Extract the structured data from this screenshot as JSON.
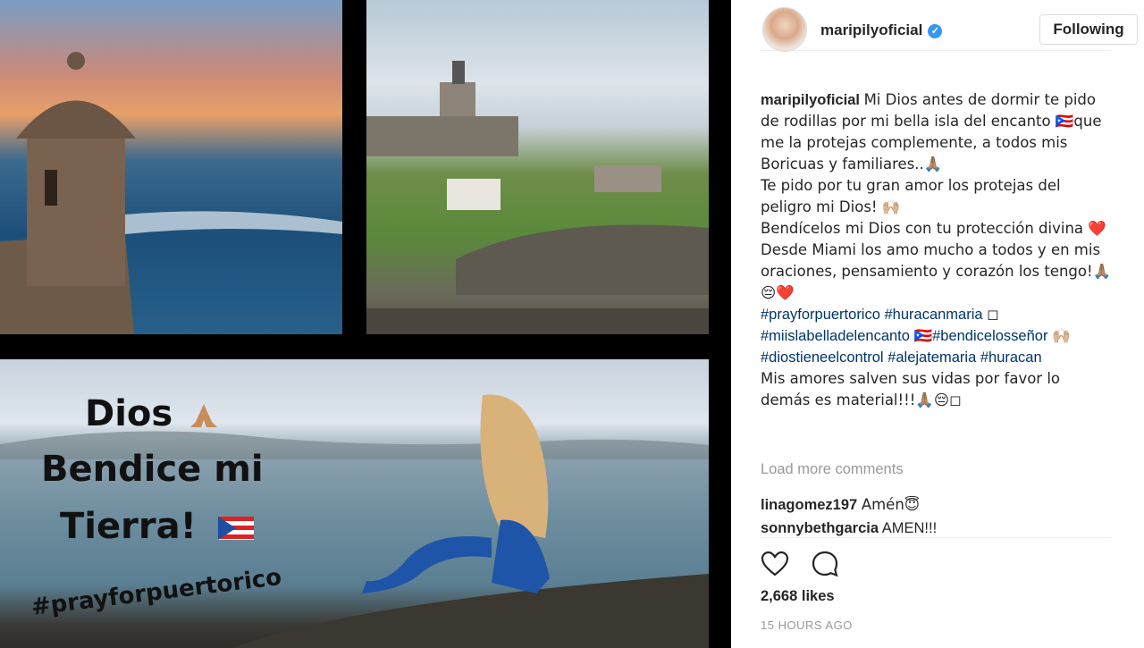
{
  "post": {
    "overlay": {
      "line1": "Dios",
      "line2": "Bendice mi",
      "line3": "Tierra!",
      "hashtag": "#prayforpuertorico"
    }
  },
  "header": {
    "username": "maripilyoficial",
    "follow_label": "Following"
  },
  "caption": {
    "username": "maripilyoficial",
    "lines": [
      "Mi Dios antes de dormir te pido de rodillas por mi bella isla del encanto 🇵🇷que me la protejas complemente, a todos mis Boricuas y familiares..🙏🏽",
      "Te pido por tu gran amor los protejas del peligro mi Dios! 🙌🏼",
      "Bendícelos mi Dios con tu protección divina ❤️",
      "Desde Miami los amo mucho a todos y en mis oraciones, pensamiento y corazón los tengo!🙏🏽😔❤️"
    ],
    "hashtags": [
      "#prayforpuertorico",
      "#huracanmaria",
      "#miislabelladelencanto",
      "#bendicelosseñor",
      "#diostieneelcontrol",
      "#alejatemaria",
      "#huracan"
    ],
    "hashtag_emojis": [
      "◻",
      "🇵🇷",
      "🙌🏼"
    ],
    "closing": "Mis amores salven sus vidas por favor lo demás es material!!!🙏🏽😔◻"
  },
  "load_more": "Load more comments",
  "comments": [
    {
      "user": "linagomez197",
      "text": "Amén😇"
    },
    {
      "user": "sonnybethgarcia",
      "text": "AMEN!!!"
    }
  ],
  "likes": "2,668 likes",
  "timestamp": "15 HOURS AGO",
  "colors": {
    "accent": "#3897f0",
    "hashtag": "#003569",
    "heart": "#ed4956"
  }
}
